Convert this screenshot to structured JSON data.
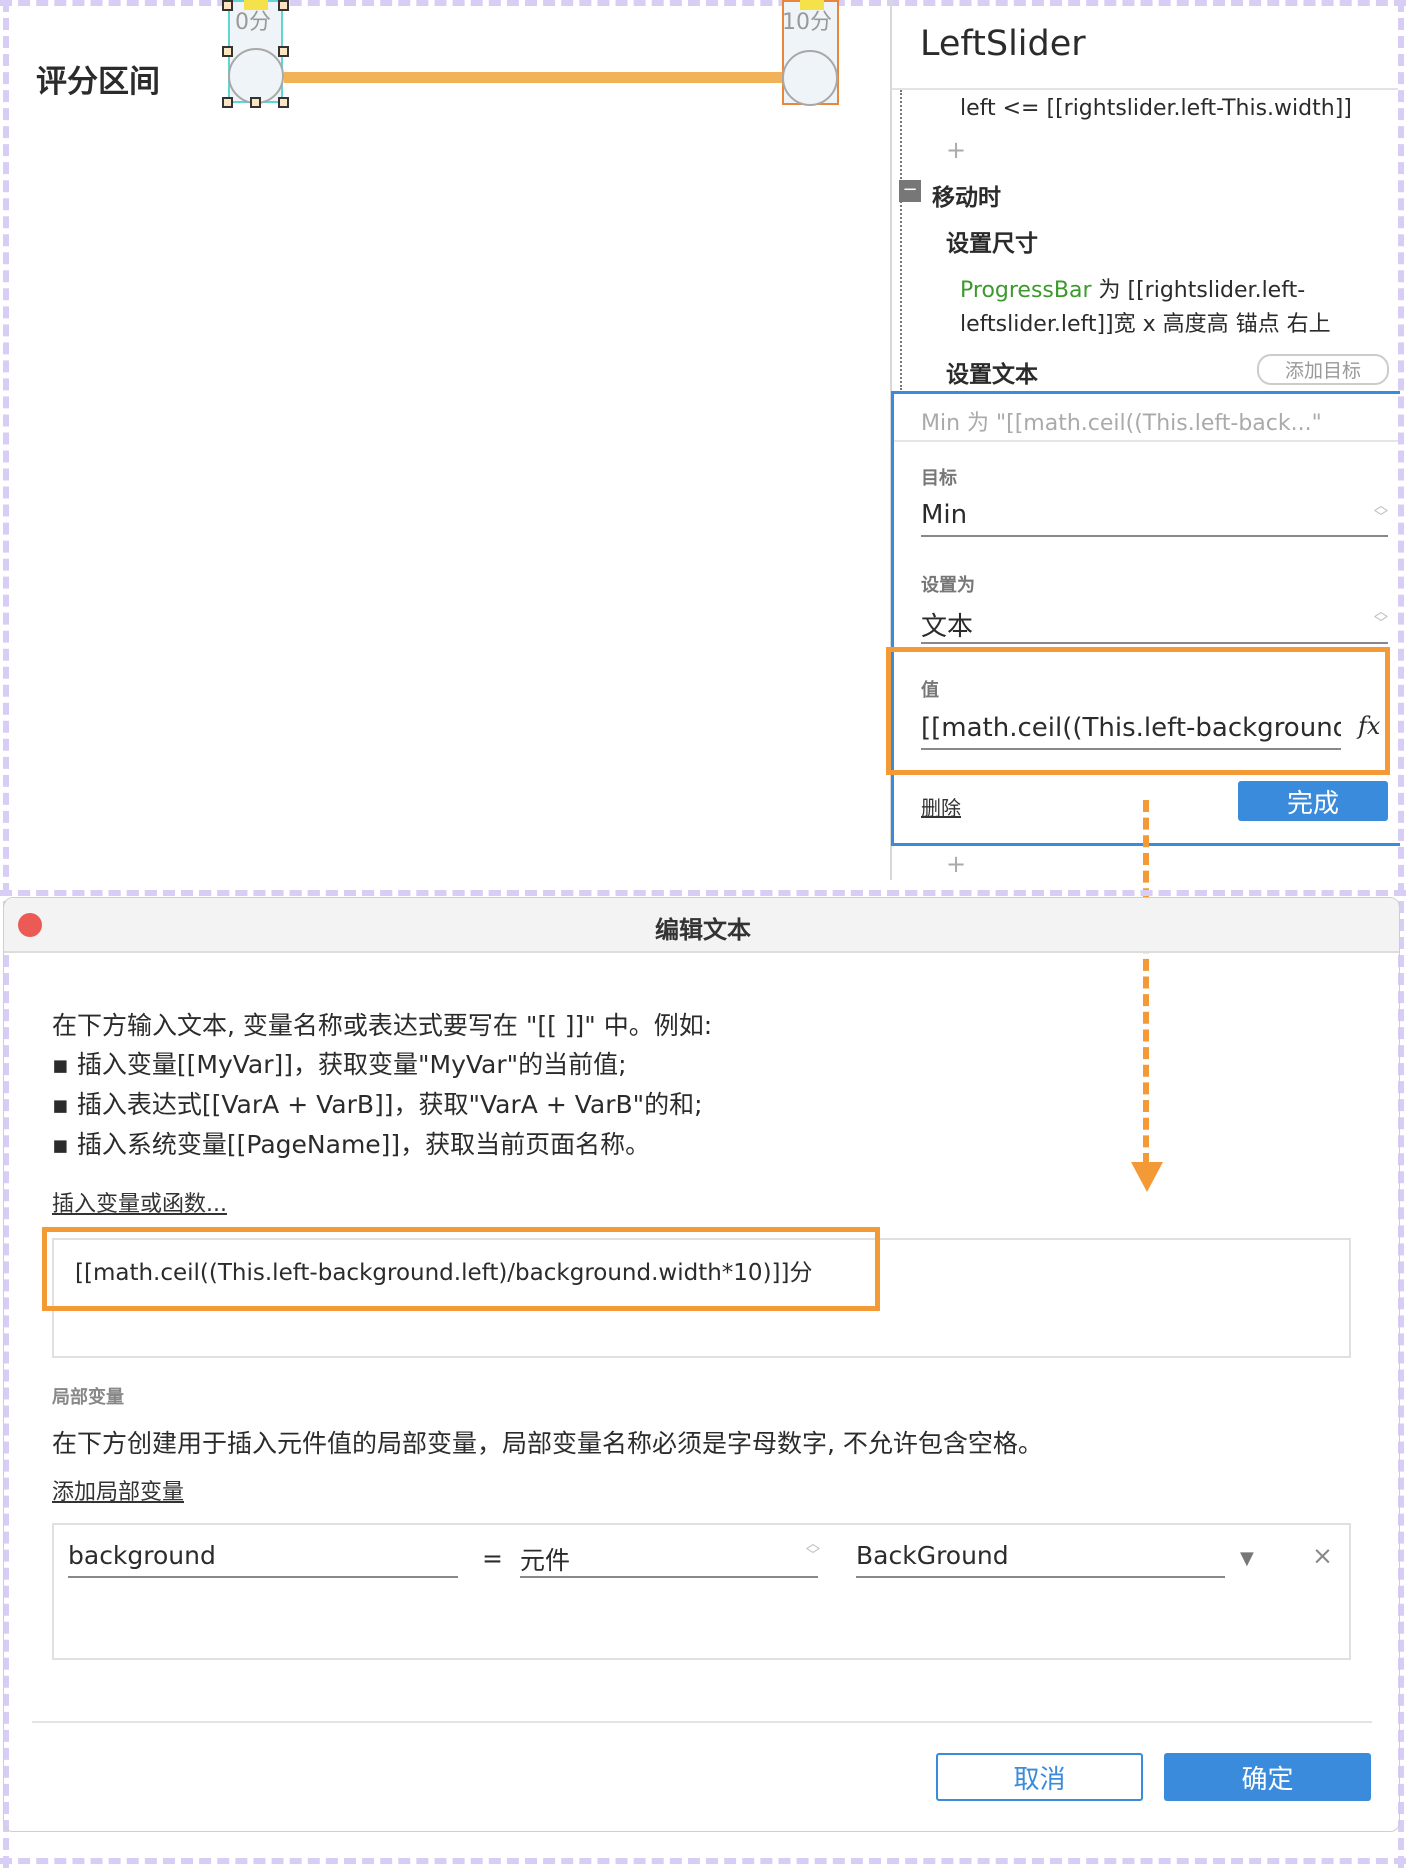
{
  "canvas": {
    "label": "评分区间",
    "left_slider_text": "0分",
    "right_slider_text": "10分",
    "colors": {
      "progress_bar": "#f2b257",
      "selection_border": "#5fd6d0",
      "right_slider_border": "#e8873c"
    }
  },
  "panel": {
    "title": "LeftSlider",
    "condition_text": "left <= [[rightslider.left-This.width]]",
    "add_icon": "plus-icon",
    "event_label": "移动时",
    "action_set_size": "设置尺寸",
    "set_size_target": "ProgressBar",
    "set_size_detail_line1": "为 [[rightslider.left-",
    "set_size_detail_line2": "leftslider.left]]宽 x 高度高  锚点 右上",
    "action_set_text": "设置文本",
    "add_target_button": "添加目标",
    "summary": "Min 为 \"[[math.ceil((This.left-back...\"",
    "target_label": "目标",
    "target_value": "Min",
    "set_as_label": "设置为",
    "set_as_value": "文本",
    "value_label": "值",
    "value_text": "[[math.ceil((This.left-background.l",
    "fx_icon": "fx",
    "delete_link": "删除",
    "done_button": "完成",
    "colors": {
      "accent": "#3a8bdb",
      "highlight": "#f39a36",
      "target_green": "#3c9a2c"
    }
  },
  "dialog": {
    "title": "编辑文本",
    "instructions": [
      "在下方输入文本, 变量名称或表达式要写在 \"[[ ]]\" 中。例如:",
      "插入变量[[MyVar]]，获取变量\"MyVar\"的当前值;",
      "插入表达式[[VarA + VarB]]，获取\"VarA + VarB\"的和;",
      "插入系统变量[[PageName]]，获取当前页面名称。"
    ],
    "insert_link": "插入变量或函数...",
    "text_value": "[[math.ceil((This.left-background.left)/background.width*10)]]分",
    "local_vars_heading": "局部变量",
    "local_vars_desc": "在下方创建用于插入元件值的局部变量，局部变量名称必须是字母数字, 不允许包含空格。",
    "add_local_var_link": "添加局部变量",
    "local_var": {
      "name": "background",
      "equals": "=",
      "type": "元件",
      "widget": "BackGround",
      "remove": "×"
    },
    "cancel_button": "取消",
    "ok_button": "确定"
  }
}
